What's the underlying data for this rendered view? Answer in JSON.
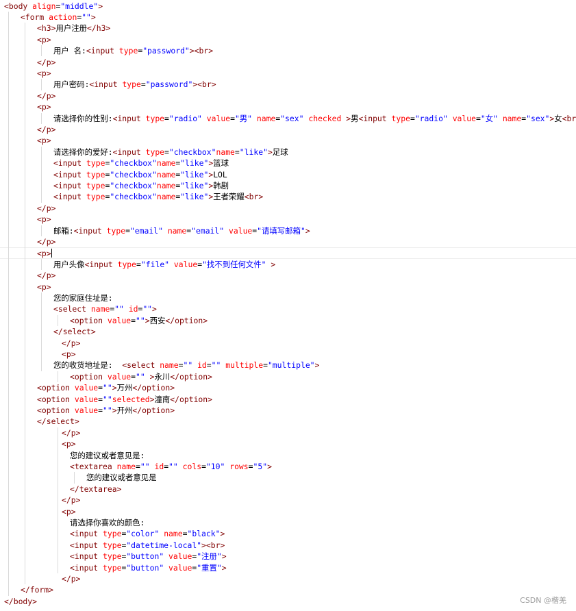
{
  "palette": {
    "text": "#000000",
    "tag": "#800000",
    "attr": "#ff0000",
    "value": "#0000ff",
    "guide": "#d9d9d9"
  },
  "watermark": "CSDN @楷羌",
  "active_line": 22,
  "code_lines": [
    {
      "indent": 0,
      "tokens": [
        [
          "tag",
          "<body"
        ],
        [
          "pl",
          " "
        ],
        [
          "attr",
          "align"
        ],
        [
          "pl",
          "="
        ],
        [
          "val",
          "\"middle\""
        ],
        [
          "tag",
          ">"
        ]
      ]
    },
    {
      "indent": 1,
      "tokens": [
        [
          "tag",
          "<form"
        ],
        [
          "pl",
          " "
        ],
        [
          "attr",
          "action"
        ],
        [
          "pl",
          "="
        ],
        [
          "val",
          "\"\""
        ],
        [
          "tag",
          ">"
        ]
      ]
    },
    {
      "indent": 2,
      "tokens": [
        [
          "tag",
          "<h3>"
        ],
        [
          "pl",
          "用户注册"
        ],
        [
          "tag",
          "</h3>"
        ]
      ]
    },
    {
      "indent": 2,
      "tokens": [
        [
          "tag",
          "<p>"
        ]
      ]
    },
    {
      "indent": 3,
      "tokens": [
        [
          "pl",
          "用户 名:"
        ],
        [
          "tag",
          "<input"
        ],
        [
          "pl",
          " "
        ],
        [
          "attr",
          "type"
        ],
        [
          "pl",
          "="
        ],
        [
          "val",
          "\"password\""
        ],
        [
          "tag",
          "><br>"
        ]
      ]
    },
    {
      "indent": 2,
      "tokens": [
        [
          "tag",
          "</p>"
        ]
      ]
    },
    {
      "indent": 2,
      "tokens": [
        [
          "tag",
          "<p>"
        ]
      ]
    },
    {
      "indent": 3,
      "tokens": [
        [
          "pl",
          "用户密码:"
        ],
        [
          "tag",
          "<input"
        ],
        [
          "pl",
          " "
        ],
        [
          "attr",
          "type"
        ],
        [
          "pl",
          "="
        ],
        [
          "val",
          "\"password\""
        ],
        [
          "tag",
          "><br>"
        ]
      ]
    },
    {
      "indent": 2,
      "tokens": [
        [
          "tag",
          "</p>"
        ]
      ]
    },
    {
      "indent": 2,
      "tokens": [
        [
          "tag",
          "<p>"
        ]
      ]
    },
    {
      "indent": 3,
      "tokens": [
        [
          "pl",
          "请选择你的性别:"
        ],
        [
          "tag",
          "<input"
        ],
        [
          "pl",
          " "
        ],
        [
          "attr",
          "type"
        ],
        [
          "pl",
          "="
        ],
        [
          "val",
          "\"radio\""
        ],
        [
          "pl",
          " "
        ],
        [
          "attr",
          "value"
        ],
        [
          "pl",
          "="
        ],
        [
          "val",
          "\"男\""
        ],
        [
          "pl",
          " "
        ],
        [
          "attr",
          "name"
        ],
        [
          "pl",
          "="
        ],
        [
          "val",
          "\"sex\""
        ],
        [
          "pl",
          " "
        ],
        [
          "attr",
          "checked"
        ],
        [
          "pl",
          " "
        ],
        [
          "tag",
          ">"
        ],
        [
          "pl",
          "男"
        ],
        [
          "tag",
          "<input"
        ],
        [
          "pl",
          " "
        ],
        [
          "attr",
          "type"
        ],
        [
          "pl",
          "="
        ],
        [
          "val",
          "\"radio\""
        ],
        [
          "pl",
          " "
        ],
        [
          "attr",
          "value"
        ],
        [
          "pl",
          "="
        ],
        [
          "val",
          "\"女\""
        ],
        [
          "pl",
          " "
        ],
        [
          "attr",
          "name"
        ],
        [
          "pl",
          "="
        ],
        [
          "val",
          "\"sex\""
        ],
        [
          "tag",
          ">"
        ],
        [
          "pl",
          "女"
        ],
        [
          "tag",
          "<br>"
        ]
      ]
    },
    {
      "indent": 2,
      "tokens": [
        [
          "tag",
          "</p>"
        ]
      ]
    },
    {
      "indent": 2,
      "tokens": [
        [
          "tag",
          "<p>"
        ]
      ]
    },
    {
      "indent": 3,
      "tokens": [
        [
          "pl",
          "请选择你的爱好:"
        ],
        [
          "tag",
          "<input"
        ],
        [
          "pl",
          " "
        ],
        [
          "attr",
          "type"
        ],
        [
          "pl",
          "="
        ],
        [
          "val",
          "\"checkbox\""
        ],
        [
          "attr",
          "name"
        ],
        [
          "pl",
          "="
        ],
        [
          "val",
          "\"like\""
        ],
        [
          "tag",
          ">"
        ],
        [
          "pl",
          "足球"
        ]
      ]
    },
    {
      "indent": 3,
      "tokens": [
        [
          "tag",
          "<input"
        ],
        [
          "pl",
          " "
        ],
        [
          "attr",
          "type"
        ],
        [
          "pl",
          "="
        ],
        [
          "val",
          "\"checkbox\""
        ],
        [
          "attr",
          "name"
        ],
        [
          "pl",
          "="
        ],
        [
          "val",
          "\"like\""
        ],
        [
          "tag",
          ">"
        ],
        [
          "pl",
          "篮球"
        ]
      ]
    },
    {
      "indent": 3,
      "tokens": [
        [
          "tag",
          "<input"
        ],
        [
          "pl",
          " "
        ],
        [
          "attr",
          "type"
        ],
        [
          "pl",
          "="
        ],
        [
          "val",
          "\"checkbox\""
        ],
        [
          "attr",
          "name"
        ],
        [
          "pl",
          "="
        ],
        [
          "val",
          "\"like\""
        ],
        [
          "tag",
          ">"
        ],
        [
          "pl",
          "LOL"
        ]
      ]
    },
    {
      "indent": 3,
      "tokens": [
        [
          "tag",
          "<input"
        ],
        [
          "pl",
          " "
        ],
        [
          "attr",
          "type"
        ],
        [
          "pl",
          "="
        ],
        [
          "val",
          "\"checkbox\""
        ],
        [
          "attr",
          "name"
        ],
        [
          "pl",
          "="
        ],
        [
          "val",
          "\"like\""
        ],
        [
          "tag",
          ">"
        ],
        [
          "pl",
          "韩剧"
        ]
      ]
    },
    {
      "indent": 3,
      "tokens": [
        [
          "tag",
          "<input"
        ],
        [
          "pl",
          " "
        ],
        [
          "attr",
          "type"
        ],
        [
          "pl",
          "="
        ],
        [
          "val",
          "\"checkbox\""
        ],
        [
          "attr",
          "name"
        ],
        [
          "pl",
          "="
        ],
        [
          "val",
          "\"like\""
        ],
        [
          "tag",
          ">"
        ],
        [
          "pl",
          "王者荣耀"
        ],
        [
          "tag",
          "<br>"
        ]
      ]
    },
    {
      "indent": 2,
      "tokens": [
        [
          "tag",
          "</p>"
        ]
      ]
    },
    {
      "indent": 2,
      "tokens": [
        [
          "tag",
          "<p>"
        ]
      ]
    },
    {
      "indent": 3,
      "tokens": [
        [
          "pl",
          "邮箱:"
        ],
        [
          "tag",
          "<input"
        ],
        [
          "pl",
          " "
        ],
        [
          "attr",
          "type"
        ],
        [
          "pl",
          "="
        ],
        [
          "val",
          "\"email\""
        ],
        [
          "pl",
          " "
        ],
        [
          "attr",
          "name"
        ],
        [
          "pl",
          "="
        ],
        [
          "val",
          "\"email\""
        ],
        [
          "pl",
          " "
        ],
        [
          "attr",
          "value"
        ],
        [
          "pl",
          "="
        ],
        [
          "val",
          "\"请填写邮箱\""
        ],
        [
          "tag",
          ">"
        ]
      ]
    },
    {
      "indent": 2,
      "tokens": [
        [
          "tag",
          "</p>"
        ]
      ]
    },
    {
      "indent": 2,
      "tokens": [
        [
          "tag",
          "<p>"
        ]
      ]
    },
    {
      "indent": 3,
      "tokens": [
        [
          "pl",
          "用户头像"
        ],
        [
          "tag",
          "<input"
        ],
        [
          "pl",
          " "
        ],
        [
          "attr",
          "type"
        ],
        [
          "pl",
          "="
        ],
        [
          "val",
          "\"file\""
        ],
        [
          "pl",
          " "
        ],
        [
          "attr",
          "value"
        ],
        [
          "pl",
          "="
        ],
        [
          "val",
          "\"找不到任何文件\""
        ],
        [
          "pl",
          " "
        ],
        [
          "tag",
          ">"
        ]
      ]
    },
    {
      "indent": 2,
      "tokens": [
        [
          "tag",
          "</p>"
        ]
      ]
    },
    {
      "indent": 2,
      "tokens": [
        [
          "tag",
          "<p>"
        ]
      ]
    },
    {
      "indent": 3,
      "tokens": [
        [
          "pl",
          "您的家庭住址是:"
        ]
      ]
    },
    {
      "indent": 3,
      "tokens": [
        [
          "tag",
          "<select"
        ],
        [
          "pl",
          " "
        ],
        [
          "attr",
          "name"
        ],
        [
          "pl",
          "="
        ],
        [
          "val",
          "\"\""
        ],
        [
          "pl",
          " "
        ],
        [
          "attr",
          "id"
        ],
        [
          "pl",
          "="
        ],
        [
          "val",
          "\"\""
        ],
        [
          "tag",
          ">"
        ]
      ]
    },
    {
      "indent": 4,
      "tokens": [
        [
          "tag",
          "<option"
        ],
        [
          "pl",
          " "
        ],
        [
          "attr",
          "value"
        ],
        [
          "pl",
          "="
        ],
        [
          "val",
          "\"\""
        ],
        [
          "tag",
          ">"
        ],
        [
          "pl",
          "西安"
        ],
        [
          "tag",
          "</option>"
        ]
      ]
    },
    {
      "indent": 3,
      "tokens": [
        [
          "tag",
          "</select>"
        ]
      ]
    },
    {
      "indent": 3.5,
      "tokens": [
        [
          "tag",
          "</p>"
        ]
      ]
    },
    {
      "indent": 3.5,
      "tokens": [
        [
          "tag",
          "<p>"
        ]
      ]
    },
    {
      "indent": 3,
      "tokens": [
        [
          "pl",
          "您的收货地址是:  "
        ],
        [
          "tag",
          "<select"
        ],
        [
          "pl",
          " "
        ],
        [
          "attr",
          "name"
        ],
        [
          "pl",
          "="
        ],
        [
          "val",
          "\"\""
        ],
        [
          "pl",
          " "
        ],
        [
          "attr",
          "id"
        ],
        [
          "pl",
          "="
        ],
        [
          "val",
          "\"\""
        ],
        [
          "pl",
          " "
        ],
        [
          "attr",
          "multiple"
        ],
        [
          "pl",
          "="
        ],
        [
          "val",
          "\"multiple\""
        ],
        [
          "tag",
          ">"
        ]
      ]
    },
    {
      "indent": 4,
      "tokens": [
        [
          "tag",
          "<option"
        ],
        [
          "pl",
          " "
        ],
        [
          "attr",
          "value"
        ],
        [
          "pl",
          "="
        ],
        [
          "val",
          "\"\""
        ],
        [
          "pl",
          " "
        ],
        [
          "tag",
          ">"
        ],
        [
          "pl",
          "永川"
        ],
        [
          "tag",
          "</option>"
        ]
      ]
    },
    {
      "indent": 2,
      "tokens": [
        [
          "tag",
          "<option"
        ],
        [
          "pl",
          " "
        ],
        [
          "attr",
          "value"
        ],
        [
          "pl",
          "="
        ],
        [
          "val",
          "\"\""
        ],
        [
          "tag",
          ">"
        ],
        [
          "pl",
          "万州"
        ],
        [
          "tag",
          "</option>"
        ]
      ]
    },
    {
      "indent": 2,
      "tokens": [
        [
          "tag",
          "<option"
        ],
        [
          "pl",
          " "
        ],
        [
          "attr",
          "value"
        ],
        [
          "pl",
          "="
        ],
        [
          "val",
          "\"\""
        ],
        [
          "attr",
          "selected"
        ],
        [
          "tag",
          ">"
        ],
        [
          "pl",
          "潼南"
        ],
        [
          "tag",
          "</option>"
        ]
      ]
    },
    {
      "indent": 2,
      "tokens": [
        [
          "tag",
          "<option"
        ],
        [
          "pl",
          " "
        ],
        [
          "attr",
          "value"
        ],
        [
          "pl",
          "="
        ],
        [
          "val",
          "\"\""
        ],
        [
          "tag",
          ">"
        ],
        [
          "pl",
          "开州"
        ],
        [
          "tag",
          "</option>"
        ]
      ]
    },
    {
      "indent": 2,
      "tokens": [
        [
          "tag",
          "</select>"
        ]
      ]
    },
    {
      "indent": 3.5,
      "tokens": [
        [
          "tag",
          "</p>"
        ]
      ]
    },
    {
      "indent": 3.5,
      "tokens": [
        [
          "tag",
          "<p>"
        ]
      ]
    },
    {
      "indent": 4,
      "tokens": [
        [
          "pl",
          "您的建议或者意见是:"
        ]
      ]
    },
    {
      "indent": 4,
      "tokens": [
        [
          "tag",
          "<textarea"
        ],
        [
          "pl",
          " "
        ],
        [
          "attr",
          "name"
        ],
        [
          "pl",
          "="
        ],
        [
          "val",
          "\"\""
        ],
        [
          "pl",
          " "
        ],
        [
          "attr",
          "id"
        ],
        [
          "pl",
          "="
        ],
        [
          "val",
          "\"\""
        ],
        [
          "pl",
          " "
        ],
        [
          "attr",
          "cols"
        ],
        [
          "pl",
          "="
        ],
        [
          "val",
          "\"10\""
        ],
        [
          "pl",
          " "
        ],
        [
          "attr",
          "rows"
        ],
        [
          "pl",
          "="
        ],
        [
          "val",
          "\"5\""
        ],
        [
          "tag",
          ">"
        ]
      ]
    },
    {
      "indent": 5,
      "tokens": [
        [
          "pl",
          "您的建议或者意见是"
        ]
      ]
    },
    {
      "indent": 4,
      "tokens": [
        [
          "tag",
          "</textarea>"
        ]
      ]
    },
    {
      "indent": 3.5,
      "tokens": [
        [
          "tag",
          "</p>"
        ]
      ]
    },
    {
      "indent": 3.5,
      "tokens": [
        [
          "tag",
          "<p>"
        ]
      ]
    },
    {
      "indent": 4,
      "tokens": [
        [
          "pl",
          "请选择你喜欢的颜色:"
        ]
      ]
    },
    {
      "indent": 4,
      "tokens": [
        [
          "tag",
          "<input"
        ],
        [
          "pl",
          " "
        ],
        [
          "attr",
          "type"
        ],
        [
          "pl",
          "="
        ],
        [
          "val",
          "\"color\""
        ],
        [
          "pl",
          " "
        ],
        [
          "attr",
          "name"
        ],
        [
          "pl",
          "="
        ],
        [
          "val",
          "\"black\""
        ],
        [
          "tag",
          ">"
        ]
      ]
    },
    {
      "indent": 4,
      "tokens": [
        [
          "tag",
          "<input"
        ],
        [
          "pl",
          " "
        ],
        [
          "attr",
          "type"
        ],
        [
          "pl",
          "="
        ],
        [
          "val",
          "\"datetime-local\""
        ],
        [
          "tag",
          "><br>"
        ]
      ]
    },
    {
      "indent": 4,
      "tokens": [
        [
          "tag",
          "<input"
        ],
        [
          "pl",
          " "
        ],
        [
          "attr",
          "type"
        ],
        [
          "pl",
          "="
        ],
        [
          "val",
          "\"button\""
        ],
        [
          "pl",
          " "
        ],
        [
          "attr",
          "value"
        ],
        [
          "pl",
          "="
        ],
        [
          "val",
          "\"注册\""
        ],
        [
          "tag",
          ">"
        ]
      ]
    },
    {
      "indent": 4,
      "tokens": [
        [
          "tag",
          "<input"
        ],
        [
          "pl",
          " "
        ],
        [
          "attr",
          "type"
        ],
        [
          "pl",
          "="
        ],
        [
          "val",
          "\"button\""
        ],
        [
          "pl",
          " "
        ],
        [
          "attr",
          "value"
        ],
        [
          "pl",
          "="
        ],
        [
          "val",
          "\"重置\""
        ],
        [
          "tag",
          ">"
        ]
      ]
    },
    {
      "indent": 3.5,
      "tokens": [
        [
          "tag",
          "</p>"
        ]
      ]
    },
    {
      "indent": 1,
      "tokens": [
        [
          "tag",
          "</form>"
        ]
      ]
    },
    {
      "indent": 0,
      "tokens": [
        [
          "tag",
          "</body>"
        ]
      ]
    }
  ]
}
